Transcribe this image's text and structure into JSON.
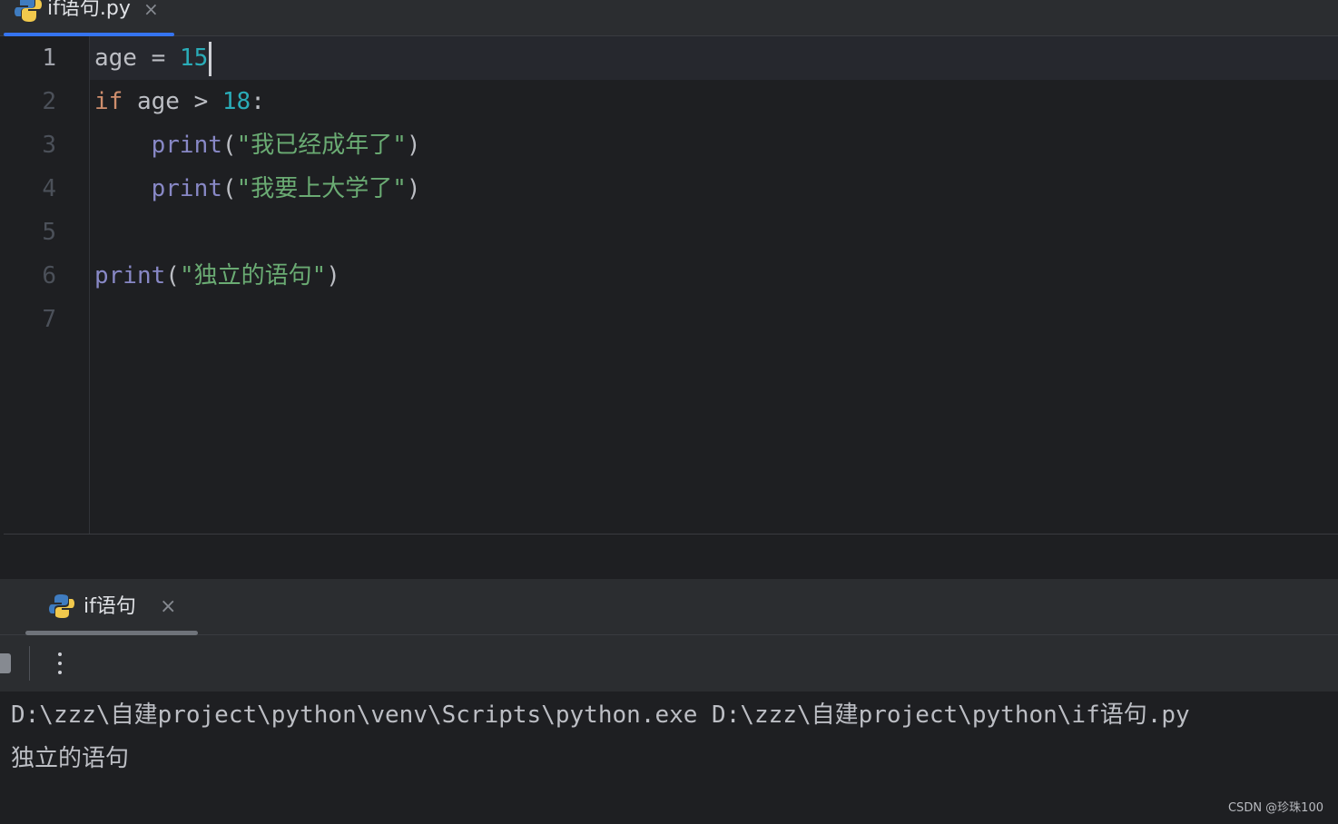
{
  "editor_tab": {
    "label": "if语句.py",
    "close": "×"
  },
  "lines": {
    "numbers": [
      "1",
      "2",
      "3",
      "4",
      "5",
      "6",
      "7"
    ],
    "l1": {
      "ident": "age",
      "op": " = ",
      "num": "15"
    },
    "l2": {
      "kw": "if",
      "mid": " age > ",
      "num": "18",
      "colon": ":"
    },
    "l3": {
      "indent": "    ",
      "fn": "print",
      "open": "(",
      "str": "\"我已经成年了\"",
      "close": ")"
    },
    "l4": {
      "indent": "    ",
      "fn": "print",
      "open": "(",
      "str": "\"我要上大学了\"",
      "close": ")"
    },
    "l6": {
      "fn": "print",
      "open": "(",
      "str": "\"独立的语句\"",
      "close": ")"
    }
  },
  "run_tab": {
    "label": "if语句",
    "close": "×"
  },
  "console": {
    "command": "D:\\zzz\\自建project\\python\\venv\\Scripts\\python.exe D:\\zzz\\自建project\\python\\if语句.py",
    "output": "独立的语句"
  },
  "watermark": "CSDN @珍珠100",
  "colors": {
    "keyword": "#cf8e6d",
    "number": "#2aacb8",
    "builtin": "#8888c6",
    "string": "#6aab73",
    "tab_underline_active": "#3574f0"
  }
}
